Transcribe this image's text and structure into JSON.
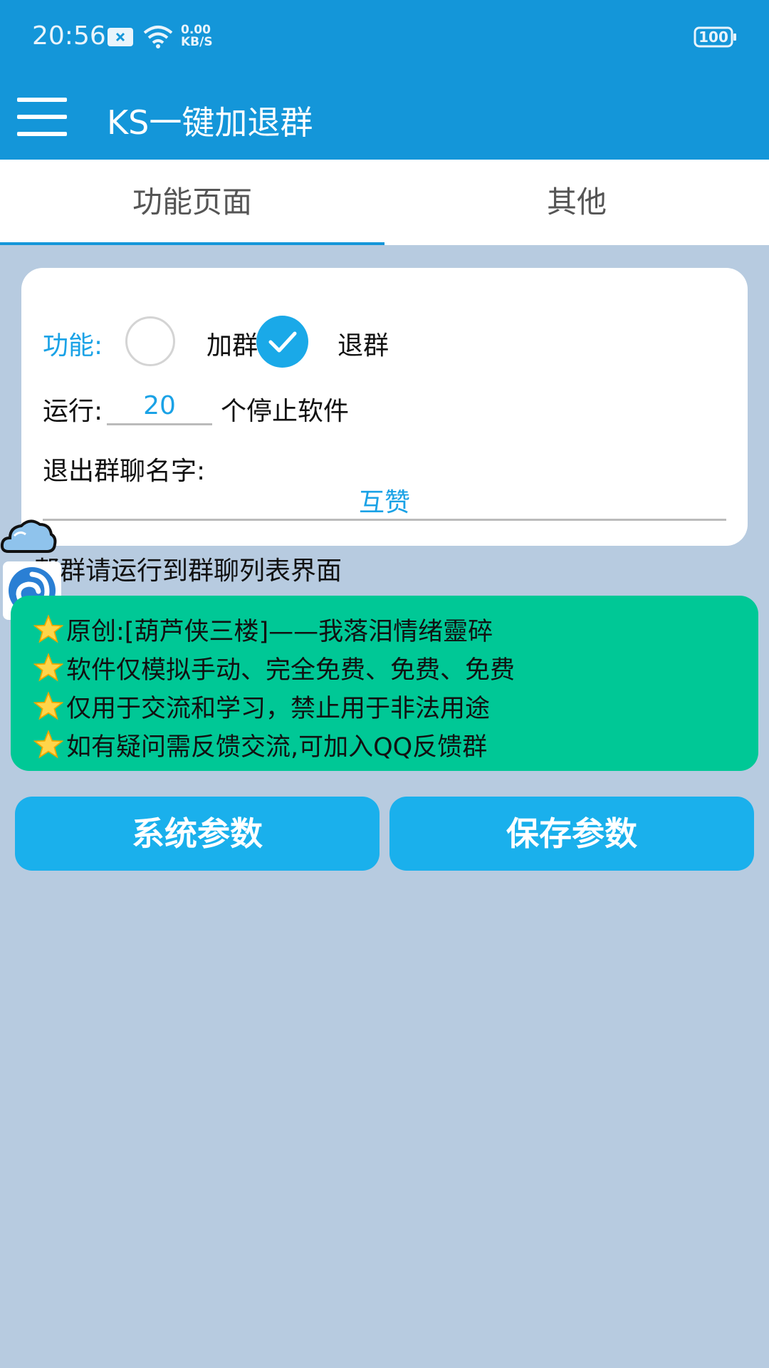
{
  "status_bar": {
    "time": "20:56",
    "net_speed_value": "0.00",
    "net_speed_unit": "KB/S",
    "battery": "100"
  },
  "app_bar": {
    "title": "KS一键加退群"
  },
  "tabs": [
    {
      "label": "功能页面",
      "active": true
    },
    {
      "label": "其他",
      "active": false
    }
  ],
  "form": {
    "function_label": "功能:",
    "options": [
      {
        "label": "加群",
        "checked": false
      },
      {
        "label": "退群",
        "checked": true
      }
    ],
    "run_label": "运行:",
    "run_value": "20",
    "run_suffix": "个停止软件",
    "quit_name_label": "退出群聊名字:",
    "quit_name_value": "互赞"
  },
  "hint": "帮群请运行到群聊列表界面",
  "info_lines": [
    "原创:[葫芦侠三楼]——我落泪情绪靈碎",
    "软件仅模拟手动、完全免费、免费、免费",
    "仅用于交流和学习，禁止用于非法用途",
    "如有疑问需反馈交流,可加入QQ反馈群"
  ],
  "buttons": {
    "system_params": "系统参数",
    "save_params": "保存参数"
  },
  "colors": {
    "primary": "#1496d9",
    "accent": "#1aa9e8",
    "green_panel": "#00c896",
    "background": "#b7cbe0"
  }
}
